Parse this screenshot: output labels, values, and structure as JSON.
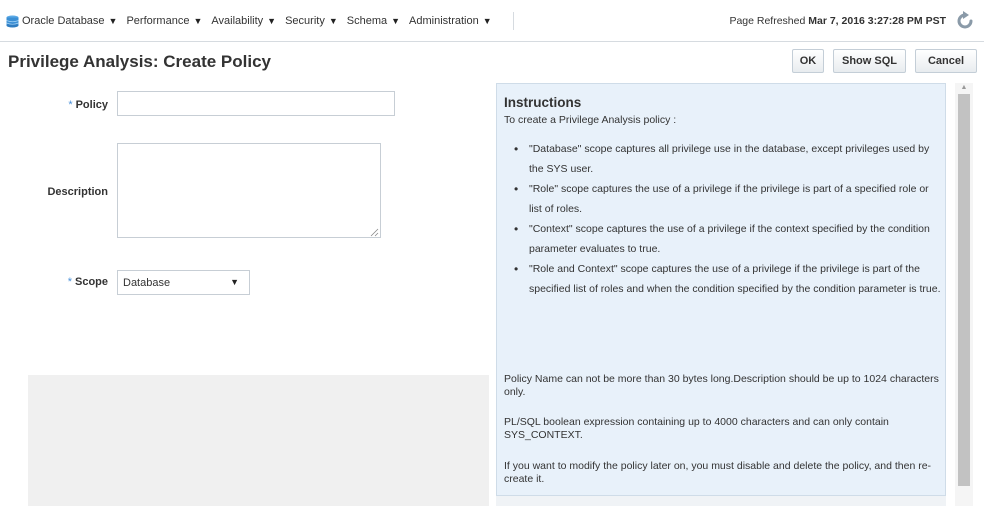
{
  "menu": {
    "items": [
      {
        "label": "Oracle Database"
      },
      {
        "label": "Performance"
      },
      {
        "label": "Availability"
      },
      {
        "label": "Security"
      },
      {
        "label": "Schema"
      },
      {
        "label": "Administration"
      }
    ],
    "database_icon": "database-icon",
    "dropdown_icon": "triangle-down-icon"
  },
  "header": {
    "refresh_prefix": "Page Refreshed",
    "refresh_time": "Mar 7, 2016 3:27:28 PM PST",
    "refresh_icon": "refresh-icon"
  },
  "page": {
    "title": "Privilege Analysis: Create Policy",
    "buttons": {
      "ok": "OK",
      "show_sql": "Show SQL",
      "cancel": "Cancel"
    }
  },
  "form": {
    "required_marker": "*",
    "policy_label": "Policy",
    "policy_value": "",
    "description_label": "Description",
    "description_value": "",
    "scope_label": "Scope",
    "scope_value": "Database"
  },
  "instructions": {
    "title": "Instructions",
    "intro": "To create a Privilege Analysis policy :",
    "bullets": [
      "\"Database\" scope captures all privilege use in the database, except privileges used by the SYS user.",
      "\"Role\" scope captures the use of a privilege if the privilege is part of a specified role or list of roles.",
      "\"Context\" scope captures the use of a privilege if the context specified by the condition parameter evaluates to true.",
      "\"Role and Context\" scope captures the use of a privilege if the privilege is part of the specified list of roles and when the condition specified by the condition parameter is true."
    ],
    "notes": [
      "Policy Name can not be more than 30 bytes long.Description should be up to 1024 characters only.",
      "PL/SQL boolean expression containing up to 4000 characters and can only contain SYS_CONTEXT.",
      "If you want to modify the policy later on, you must disable and delete the policy, and then re-create it."
    ]
  },
  "colors": {
    "instructions_bg": "#e8f1fa",
    "required_star": "#4a90d9",
    "database_icon": "#3b8fd4"
  }
}
